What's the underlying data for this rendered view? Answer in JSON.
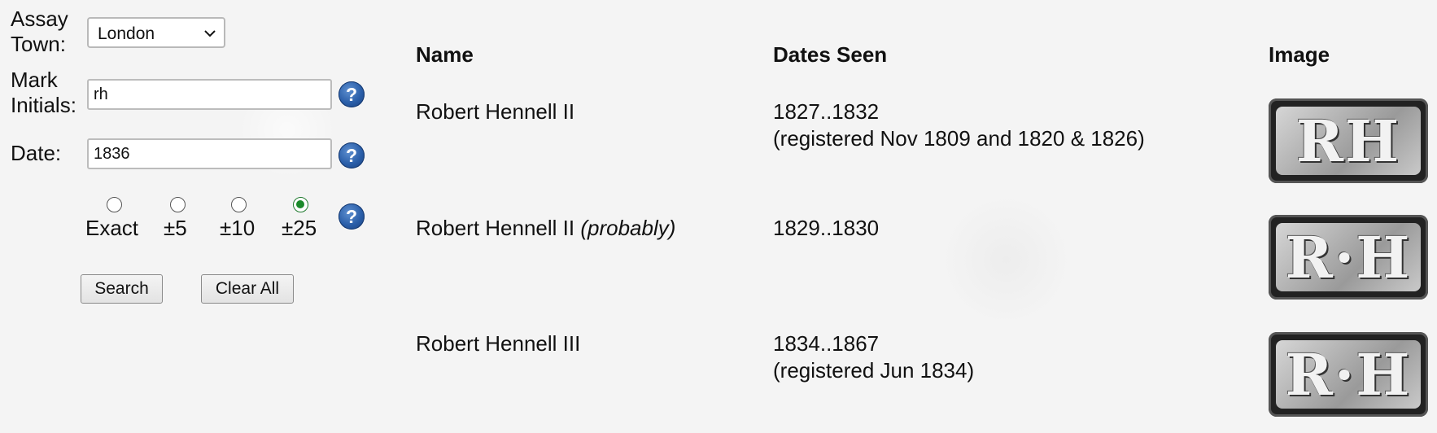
{
  "form": {
    "assay_town_label_1": "Assay",
    "assay_town_label_2": "Town:",
    "assay_town_value": "London",
    "mark_initials_label_1": "Mark",
    "mark_initials_label_2": "Initials:",
    "mark_initials_value": "rh",
    "date_label": "Date:",
    "date_value": "1836",
    "help_glyph": "?",
    "range_options": [
      {
        "label": "Exact",
        "selected": false
      },
      {
        "label": "±5",
        "selected": false
      },
      {
        "label": "±10",
        "selected": false
      },
      {
        "label": "±25",
        "selected": true
      }
    ],
    "search_label": "Search",
    "clear_label": "Clear All"
  },
  "results": {
    "headers": {
      "name": "Name",
      "dates": "Dates Seen",
      "image": "Image"
    },
    "rows": [
      {
        "name": "Robert Hennell II",
        "qualifier": "",
        "dates": "1827..1832",
        "registered": "(registered Nov 1809 and 1820 & 1826)",
        "mark_text": "RH"
      },
      {
        "name": "Robert Hennell II",
        "qualifier": "(probably)",
        "dates": "1829..1830",
        "registered": "",
        "mark_text": "R·H"
      },
      {
        "name": "Robert Hennell III",
        "qualifier": "",
        "dates": "1834..1867",
        "registered": "(registered Jun 1834)",
        "mark_text": "R·H"
      }
    ]
  },
  "icons": {
    "help": "help-circle-icon",
    "dropdown": "chevron-down-icon"
  },
  "colors": {
    "help_blue": "#2a5ea8",
    "radio_selected": "#1a8a2a"
  }
}
